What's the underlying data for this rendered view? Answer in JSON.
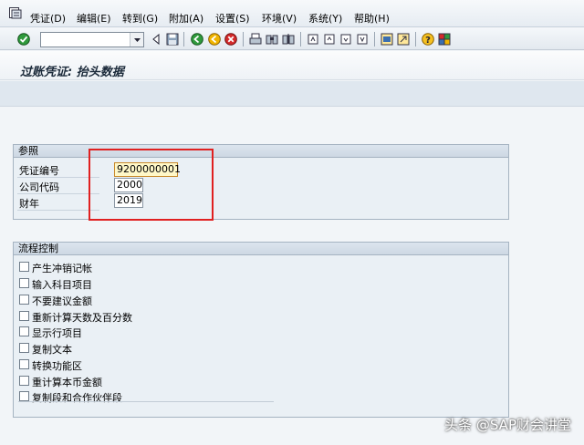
{
  "menu": {
    "items": [
      "凭证(D)",
      "编辑(E)",
      "转到(G)",
      "附加(A)",
      "设置(S)",
      "环境(V)",
      "系统(Y)",
      "帮助(H)"
    ]
  },
  "toolbar": {
    "command_field_value": ""
  },
  "page": {
    "title": "过账凭证: 抬头数据"
  },
  "reference_group": {
    "title": "参照",
    "fields": [
      {
        "label": "凭证编号",
        "value": "9200000001"
      },
      {
        "label": "公司代码",
        "value": "2000"
      },
      {
        "label": "财年",
        "value": "2019"
      }
    ]
  },
  "flow_control_group": {
    "title": "流程控制",
    "options": [
      {
        "label": "产生冲销记帐",
        "checked": false
      },
      {
        "label": "输入科目项目",
        "checked": false
      },
      {
        "label": "不要建议金额",
        "checked": false
      },
      {
        "label": "重新计算天数及百分数",
        "checked": false
      },
      {
        "label": "显示行项目",
        "checked": false
      },
      {
        "label": "复制文本",
        "checked": false
      },
      {
        "label": "转换功能区",
        "checked": false
      },
      {
        "label": "重计算本币金额",
        "checked": false
      },
      {
        "label": "复制段和合作伙伴段",
        "checked": false
      }
    ]
  },
  "watermark": "头条 @SAP财会讲堂",
  "colors": {
    "highlight": "#e02020",
    "focused_field": "#fff8c8"
  }
}
